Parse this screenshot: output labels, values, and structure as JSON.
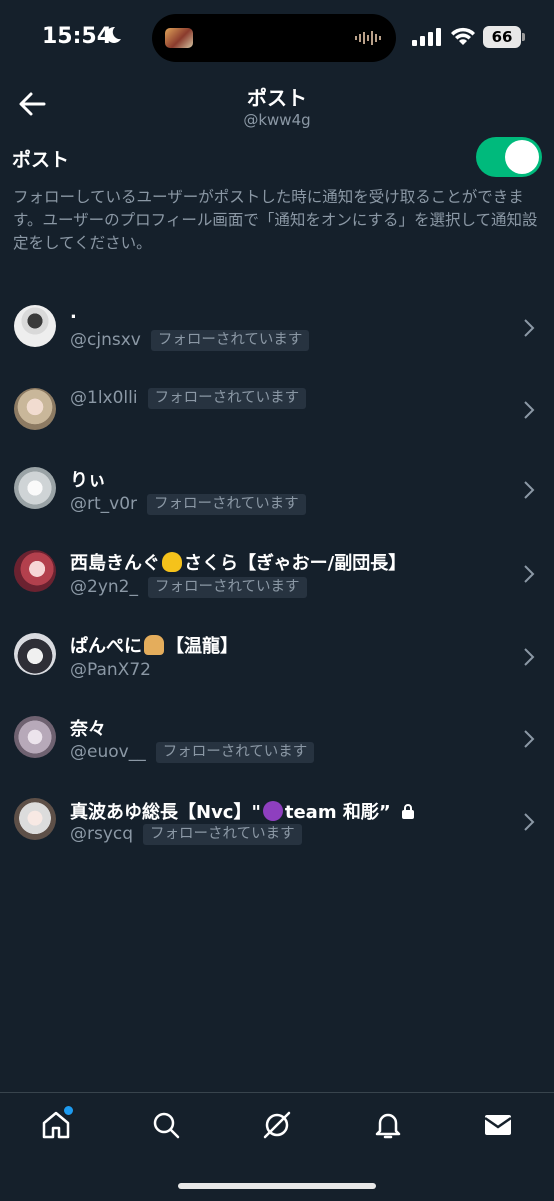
{
  "status": {
    "time": "15:54",
    "battery": "66"
  },
  "header": {
    "title": "ポスト",
    "subtitle": "@kww4g"
  },
  "setting": {
    "label": "ポスト",
    "enabled": true,
    "description": "フォローしているユーザーがポストした時に通知を受け取ることができます。ユーザーのプロフィール画面で「通知をオンにする」を選択して通知設定をしてください。"
  },
  "users": [
    {
      "name": ".",
      "handle": "@cjnsxv",
      "badge": "フォローされています"
    },
    {
      "name": "",
      "handle": "@1lx0lli",
      "badge": "フォローされています"
    },
    {
      "name": "りぃ",
      "handle": "@rt_v0r",
      "badge": "フォローされています"
    },
    {
      "name_pre": "西島きんぐ",
      "name_post": "さくら【ぎゃおー/副団長】",
      "emoji": "heart-hands",
      "handle": "@2yn2_",
      "badge": "フォローされています"
    },
    {
      "name_pre": "ぱんぺに",
      "name_post": "【温龍】",
      "emoji": "bread",
      "handle": "@PanX72",
      "badge": ""
    },
    {
      "name": "奈々",
      "handle": "@euov__",
      "badge": "フォローされています"
    },
    {
      "name_pre": "真波あゆ総長【Nvc】\"",
      "name_post": "team 和彫”",
      "emoji": "purple-devil",
      "protected": true,
      "handle": "@rsycq",
      "badge": "フォローされています"
    }
  ],
  "tabs": [
    "home-icon",
    "search-icon",
    "grok-icon",
    "notifications-icon",
    "messages-icon"
  ],
  "colors": {
    "background": "#15202b",
    "accent": "#1d9bf0",
    "toggle_on": "#00ba7c",
    "secondary_text": "#8b98a5",
    "badge_bg": "#273340"
  }
}
